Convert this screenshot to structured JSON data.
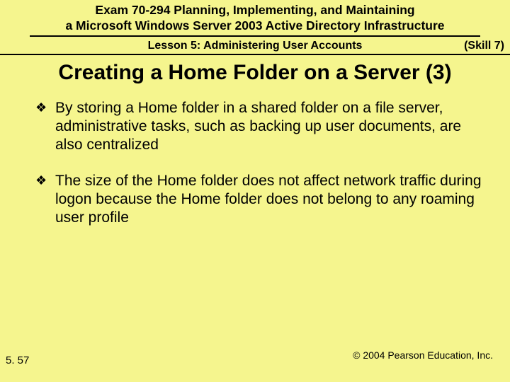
{
  "header": {
    "line1": "Exam 70-294 Planning, Implementing, and Maintaining",
    "line2": "a Microsoft Windows Server 2003 Active Directory Infrastructure"
  },
  "subheader": {
    "lesson": "Lesson 5: Administering User Accounts",
    "skill": "(Skill 7)"
  },
  "title": "Creating a Home Folder on a Server (3)",
  "bullets": [
    "By storing a Home folder in a shared folder on a file server, administrative tasks, such as backing up user documents, are also centralized",
    "The size of the Home folder does not affect network traffic during logon because the Home folder does not belong to any roaming user profile"
  ],
  "footer": {
    "page": "5. 57",
    "copyright": "© 2004 Pearson Education, Inc."
  },
  "glyphs": {
    "bullet": "❖"
  }
}
